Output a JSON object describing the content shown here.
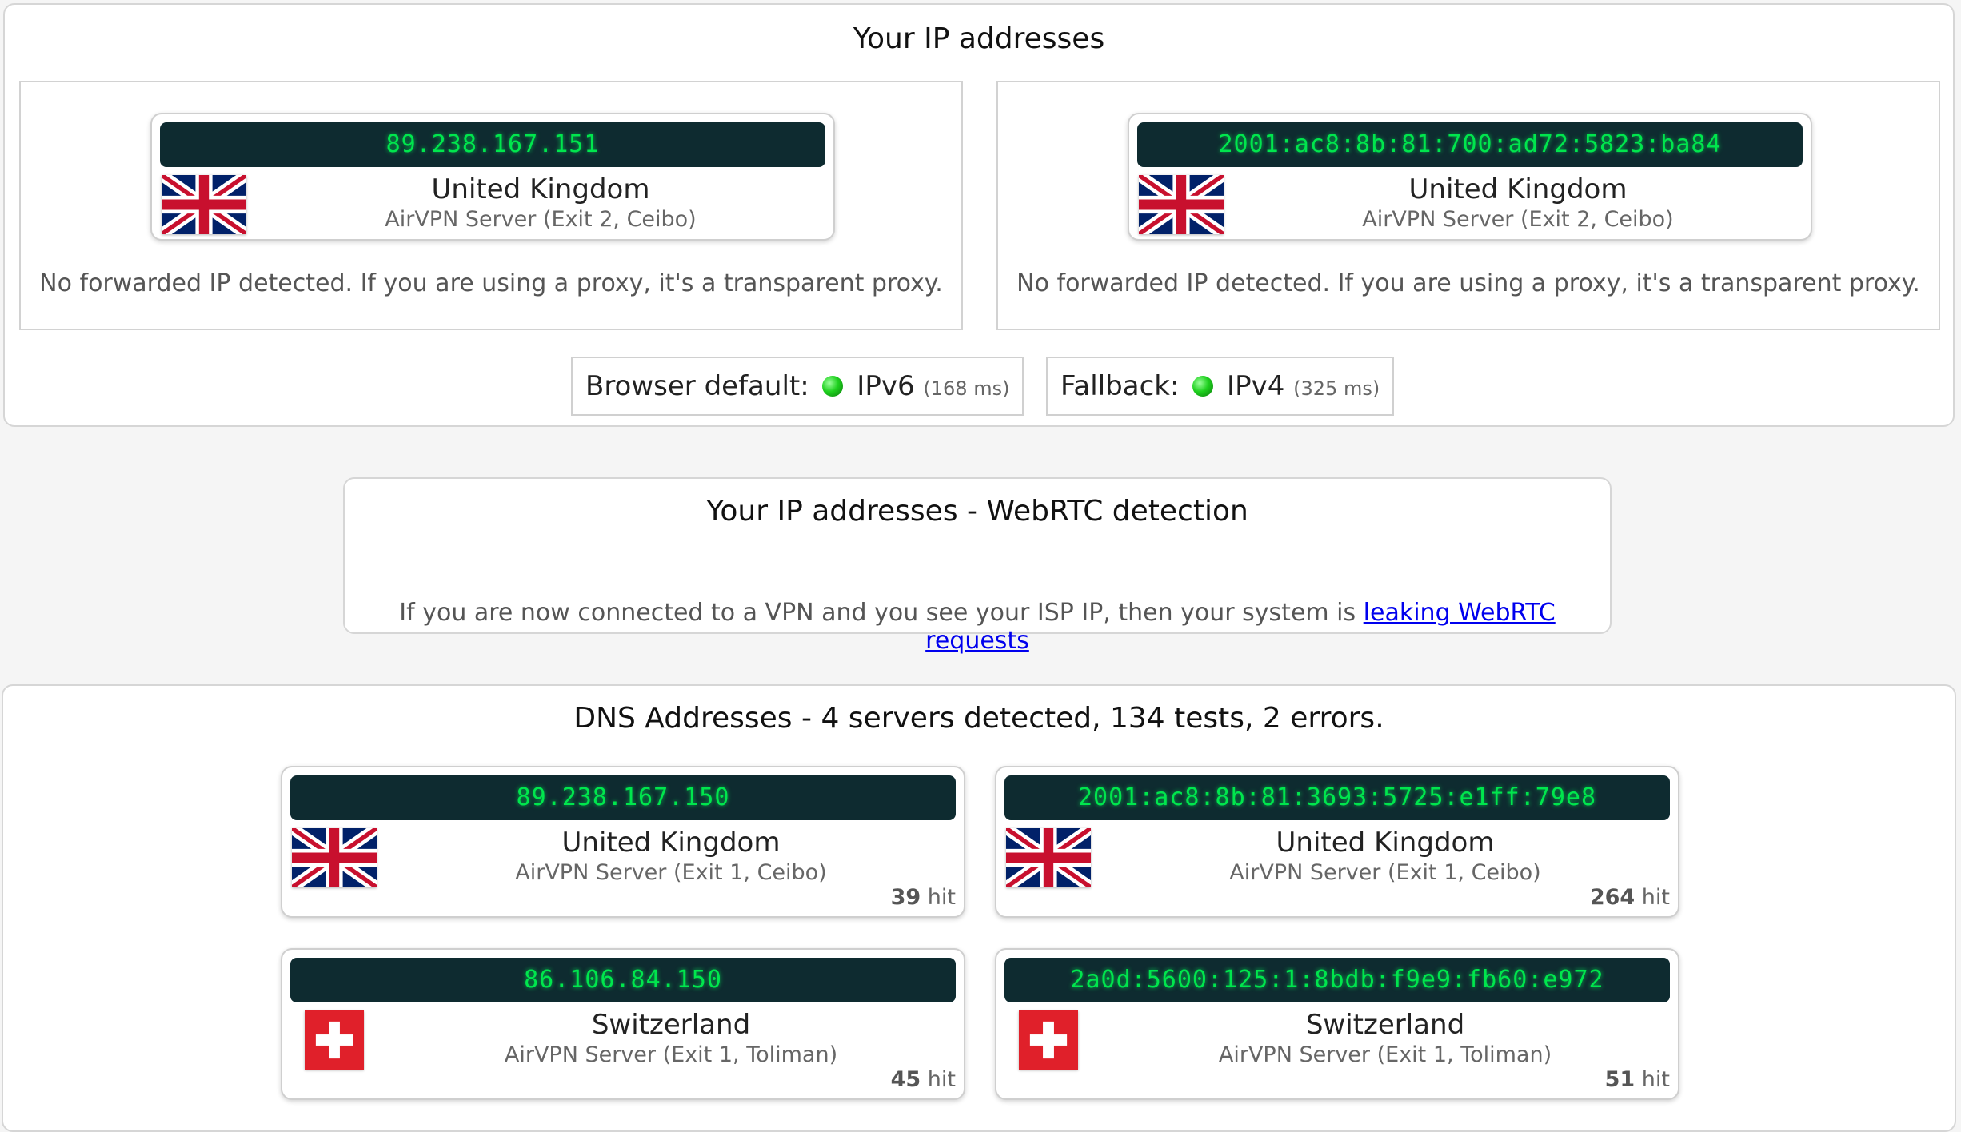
{
  "ip_section": {
    "title": "Your IP addresses",
    "ipv4": {
      "ip": "89.238.167.151",
      "country": "United Kingdom",
      "server": "AirVPN Server (Exit 2, Ceibo)",
      "note": "No forwarded IP detected. If you are using a proxy, it's a transparent proxy."
    },
    "ipv6": {
      "ip": "2001:ac8:8b:81:700:ad72:5823:ba84",
      "country": "United Kingdom",
      "server": "AirVPN Server (Exit 2, Ceibo)",
      "note": "No forwarded IP detected. If you are using a proxy, it's a transparent proxy."
    },
    "browser_default": {
      "label": "Browser default:",
      "protocol": "IPv6",
      "latency": "(168 ms)"
    },
    "fallback": {
      "label": "Fallback:",
      "protocol": "IPv4",
      "latency": "(325 ms)"
    }
  },
  "webrtc_section": {
    "title": "Your IP addresses - WebRTC detection",
    "note": "If you are now connected to a VPN and you see your ISP IP, then your system is",
    "link_text": "leaking WebRTC requests"
  },
  "dns_section": {
    "title": "DNS Addresses - 4 servers detected, 134 tests, 2 errors.",
    "hit_label": "hit",
    "servers": [
      {
        "ip": "89.238.167.150",
        "country": "United Kingdom",
        "server": "AirVPN Server (Exit 1, Ceibo)",
        "hits": "39",
        "flag": "uk-flag"
      },
      {
        "ip": "2001:ac8:8b:81:3693:5725:e1ff:79e8",
        "country": "United Kingdom",
        "server": "AirVPN Server (Exit 1, Ceibo)",
        "hits": "264",
        "flag": "uk-flag"
      },
      {
        "ip": "86.106.84.150",
        "country": "Switzerland",
        "server": "AirVPN Server (Exit 1, Toliman)",
        "hits": "45",
        "flag": "swiss-flag"
      },
      {
        "ip": "2a0d:5600:125:1:8bdb:f9e9:fb60:e972",
        "country": "Switzerland",
        "server": "AirVPN Server (Exit 1, Toliman)",
        "hits": "51",
        "flag": "swiss-flag"
      }
    ]
  },
  "colors": {
    "ip_bar_bg": "#0e2b30",
    "ip_text": "#00e64d",
    "status_green": "#1fd11f",
    "link": "#0000ee"
  }
}
